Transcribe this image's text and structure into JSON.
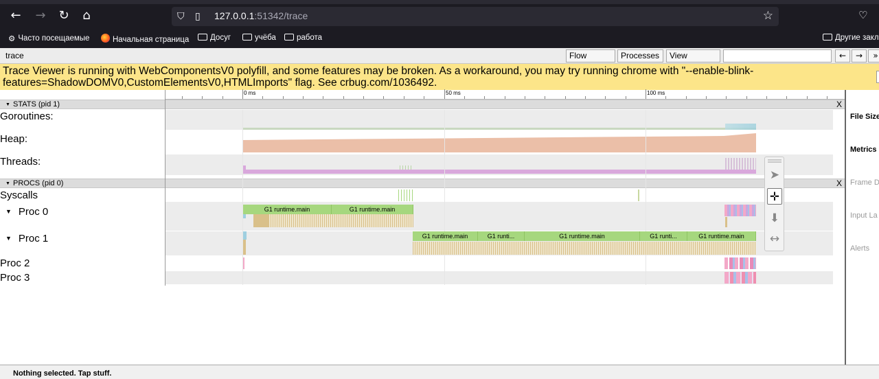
{
  "browser": {
    "url_host": "127.0.0.1",
    "url_rest": ":51342/trace",
    "bookmarks": [
      "Часто посещаемые",
      "Начальная страница",
      "Досуг",
      "учёба",
      "работа"
    ],
    "other_bookmarks": "Другие закл"
  },
  "viewer": {
    "title": "trace",
    "buttons": {
      "flow": "Flow events",
      "processes": "Processes",
      "view": "View Options"
    },
    "nav": {
      "prev": "←",
      "next": "→",
      "more": "»"
    },
    "warning": "Trace Viewer is running with WebComponentsV0 polyfill, and some features may be broken. As a workaround, you may try running chrome with \"--enable-blink-features=ShadowDOMV0,CustomElementsV0,HTMLImports\" flag. See crbug.com/1036492.",
    "ruler": [
      "0 ms",
      "50 ms",
      "100 ms"
    ],
    "stats_header": "STATS (pid 1)",
    "procs_header": "PROCS (pid 0)",
    "close": "X",
    "tracks": {
      "goroutines": "Goroutines:",
      "heap": "Heap:",
      "threads": "Threads:",
      "syscalls": "Syscalls",
      "proc0": "Proc 0",
      "proc1": "Proc 1",
      "proc2": "Proc 2",
      "proc3": "Proc 3"
    },
    "slices": {
      "p0a": "G1 runtime.main",
      "p0b": "G1 runtime.main",
      "p1a": "G1 runtime.main",
      "p1b": "G1 runti...",
      "p1c": "G1 runtime.main",
      "p1d": "G1 runti...",
      "p1e": "G1 runtime.main"
    },
    "side_panel": [
      "File Size",
      "Metrics",
      "Frame D",
      "Input La",
      "Alerts"
    ],
    "status": "Nothing selected. Tap stuff."
  },
  "colors": {
    "slice_green": "#a6d77e",
    "heap_fill": "#ebbfa8",
    "threads_fill": "#d9a8dc",
    "warning_bg": "#fce589"
  }
}
